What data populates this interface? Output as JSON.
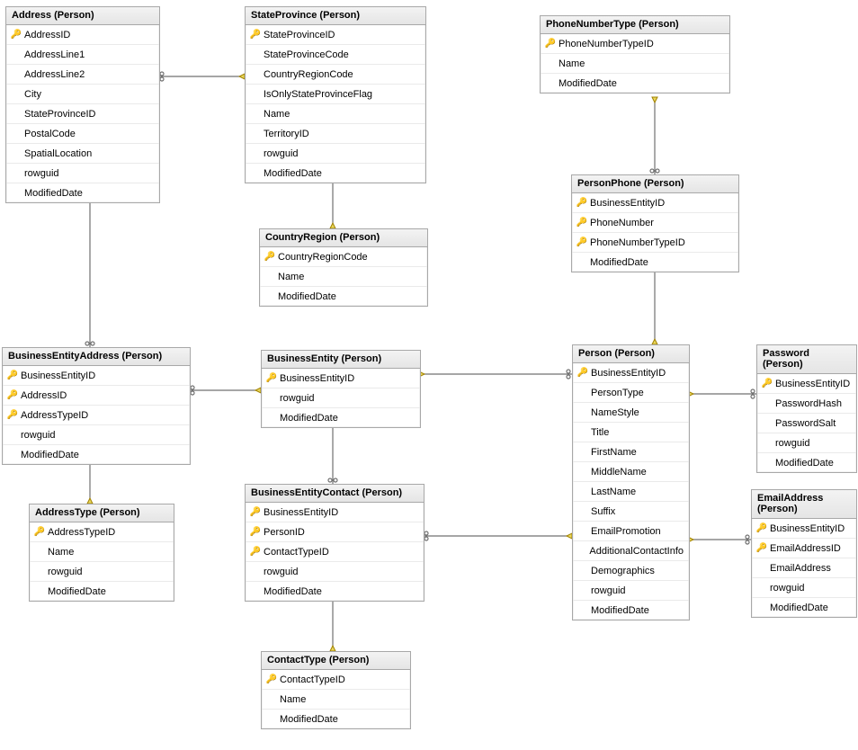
{
  "key_glyph": "🔑",
  "tables": [
    {
      "title": "Address (Person)",
      "columns": [
        {
          "key": true,
          "name": "AddressID"
        },
        {
          "key": false,
          "name": "AddressLine1"
        },
        {
          "key": false,
          "name": "AddressLine2"
        },
        {
          "key": false,
          "name": "City"
        },
        {
          "key": false,
          "name": "StateProvinceID"
        },
        {
          "key": false,
          "name": "PostalCode"
        },
        {
          "key": false,
          "name": "SpatialLocation"
        },
        {
          "key": false,
          "name": "rowguid"
        },
        {
          "key": false,
          "name": "ModifiedDate"
        }
      ]
    },
    {
      "title": "StateProvince (Person)",
      "columns": [
        {
          "key": true,
          "name": "StateProvinceID"
        },
        {
          "key": false,
          "name": "StateProvinceCode"
        },
        {
          "key": false,
          "name": "CountryRegionCode"
        },
        {
          "key": false,
          "name": "IsOnlyStateProvinceFlag"
        },
        {
          "key": false,
          "name": "Name"
        },
        {
          "key": false,
          "name": "TerritoryID"
        },
        {
          "key": false,
          "name": "rowguid"
        },
        {
          "key": false,
          "name": "ModifiedDate"
        }
      ]
    },
    {
      "title": "PhoneNumberType (Person)",
      "columns": [
        {
          "key": true,
          "name": "PhoneNumberTypeID"
        },
        {
          "key": false,
          "name": "Name"
        },
        {
          "key": false,
          "name": "ModifiedDate"
        }
      ]
    },
    {
      "title": "PersonPhone (Person)",
      "columns": [
        {
          "key": true,
          "name": "BusinessEntityID"
        },
        {
          "key": true,
          "name": "PhoneNumber"
        },
        {
          "key": true,
          "name": "PhoneNumberTypeID"
        },
        {
          "key": false,
          "name": "ModifiedDate"
        }
      ]
    },
    {
      "title": "CountryRegion (Person)",
      "columns": [
        {
          "key": true,
          "name": "CountryRegionCode"
        },
        {
          "key": false,
          "name": "Name"
        },
        {
          "key": false,
          "name": "ModifiedDate"
        }
      ]
    },
    {
      "title": "BusinessEntityAddress (Person)",
      "columns": [
        {
          "key": true,
          "name": "BusinessEntityID"
        },
        {
          "key": true,
          "name": "AddressID"
        },
        {
          "key": true,
          "name": "AddressTypeID"
        },
        {
          "key": false,
          "name": "rowguid"
        },
        {
          "key": false,
          "name": "ModifiedDate"
        }
      ]
    },
    {
      "title": "BusinessEntity (Person)",
      "columns": [
        {
          "key": true,
          "name": "BusinessEntityID"
        },
        {
          "key": false,
          "name": "rowguid"
        },
        {
          "key": false,
          "name": "ModifiedDate"
        }
      ]
    },
    {
      "title": "Person (Person)",
      "columns": [
        {
          "key": true,
          "name": "BusinessEntityID"
        },
        {
          "key": false,
          "name": "PersonType"
        },
        {
          "key": false,
          "name": "NameStyle"
        },
        {
          "key": false,
          "name": "Title"
        },
        {
          "key": false,
          "name": "FirstName"
        },
        {
          "key": false,
          "name": "MiddleName"
        },
        {
          "key": false,
          "name": "LastName"
        },
        {
          "key": false,
          "name": "Suffix"
        },
        {
          "key": false,
          "name": "EmailPromotion"
        },
        {
          "key": false,
          "name": "AdditionalContactInfo"
        },
        {
          "key": false,
          "name": "Demographics"
        },
        {
          "key": false,
          "name": "rowguid"
        },
        {
          "key": false,
          "name": "ModifiedDate"
        }
      ]
    },
    {
      "title": "Password (Person)",
      "columns": [
        {
          "key": true,
          "name": "BusinessEntityID"
        },
        {
          "key": false,
          "name": "PasswordHash"
        },
        {
          "key": false,
          "name": "PasswordSalt"
        },
        {
          "key": false,
          "name": "rowguid"
        },
        {
          "key": false,
          "name": "ModifiedDate"
        }
      ]
    },
    {
      "title": "AddressType (Person)",
      "columns": [
        {
          "key": true,
          "name": "AddressTypeID"
        },
        {
          "key": false,
          "name": "Name"
        },
        {
          "key": false,
          "name": "rowguid"
        },
        {
          "key": false,
          "name": "ModifiedDate"
        }
      ]
    },
    {
      "title": "BusinessEntityContact (Person)",
      "columns": [
        {
          "key": true,
          "name": "BusinessEntityID"
        },
        {
          "key": true,
          "name": "PersonID"
        },
        {
          "key": true,
          "name": "ContactTypeID"
        },
        {
          "key": false,
          "name": "rowguid"
        },
        {
          "key": false,
          "name": "ModifiedDate"
        }
      ]
    },
    {
      "title": "EmailAddress (Person)",
      "columns": [
        {
          "key": true,
          "name": "BusinessEntityID"
        },
        {
          "key": true,
          "name": "EmailAddressID"
        },
        {
          "key": false,
          "name": "EmailAddress"
        },
        {
          "key": false,
          "name": "rowguid"
        },
        {
          "key": false,
          "name": "ModifiedDate"
        }
      ]
    },
    {
      "title": "ContactType (Person)",
      "columns": [
        {
          "key": true,
          "name": "ContactTypeID"
        },
        {
          "key": false,
          "name": "Name"
        },
        {
          "key": false,
          "name": "ModifiedDate"
        }
      ]
    }
  ]
}
